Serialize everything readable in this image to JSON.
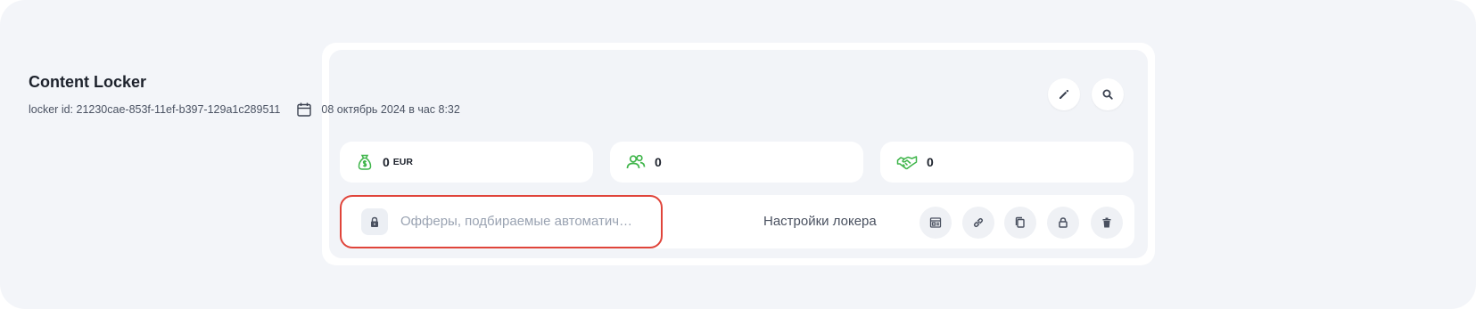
{
  "locker": {
    "title": "Content Locker",
    "id_text": "locker id: 21230cae-853f-11ef-b397-129a1c289511",
    "date_text": "08 октябрь 2024 в час 8:32"
  },
  "header_actions": [
    {
      "icon": "pencil-icon"
    },
    {
      "icon": "search-icon"
    }
  ],
  "stats": {
    "revenue": {
      "value": "0",
      "unit": "EUR",
      "icon": "money-bag-icon"
    },
    "users": {
      "value": "0",
      "icon": "users-icon"
    },
    "conversions": {
      "value": "0",
      "icon": "handshake-icon"
    }
  },
  "offers": {
    "text": "Офферы, подбираемые автоматич…",
    "icon": "lock-icon"
  },
  "settings_label": "Настройки локера",
  "row_actions": [
    {
      "icon": "preview-icon"
    },
    {
      "icon": "link-icon"
    },
    {
      "icon": "copy-icon"
    },
    {
      "icon": "lock-icon"
    },
    {
      "icon": "trash-icon"
    }
  ],
  "colors": {
    "green": "#3fb54a",
    "highlight": "#e0443a",
    "muted_text": "#9aa3b2"
  }
}
